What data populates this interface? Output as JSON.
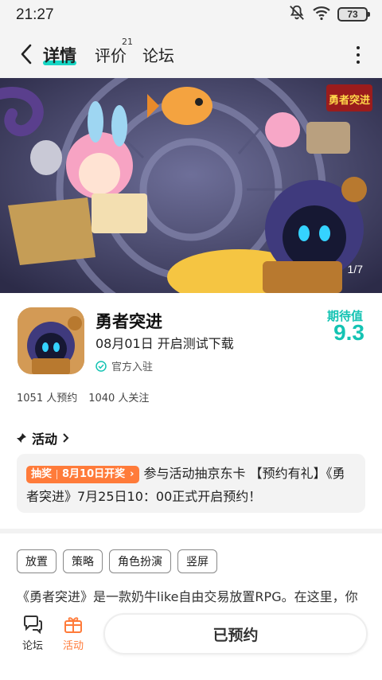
{
  "status_bar": {
    "time": "21:27",
    "battery": "73"
  },
  "nav": {
    "tabs": [
      {
        "label": "详情"
      },
      {
        "label": "评价",
        "count": "21"
      },
      {
        "label": "论坛"
      }
    ]
  },
  "banner": {
    "counter": "1/7",
    "logo_text": "勇者突进"
  },
  "app": {
    "name": "勇者突进",
    "date": "08月01日 开启测试下载",
    "official": "官方入驻",
    "rating_label": "期待值",
    "rating_value": "9.3",
    "reservations": "1051 人预约",
    "followers": "1040 人关注"
  },
  "activity": {
    "header": "活动",
    "badge_type": "抽奖",
    "badge_date": "8月10日开奖",
    "text": "参与活动抽京东卡 【预约有礼】《勇者突进》7月25日10：00正式开启预约！"
  },
  "tags": [
    "放置",
    "策略",
    "角色扮演",
    "竖屏"
  ],
  "description": "《勇者突进》是一款奶牛like自由交易放置RPG。在这里，你",
  "bottom": {
    "forum_label": "论坛",
    "activity_label": "活动",
    "reserve_label": "已预约"
  },
  "colors": {
    "accent": "#14c3b3",
    "orange": "#ff7b3a"
  }
}
